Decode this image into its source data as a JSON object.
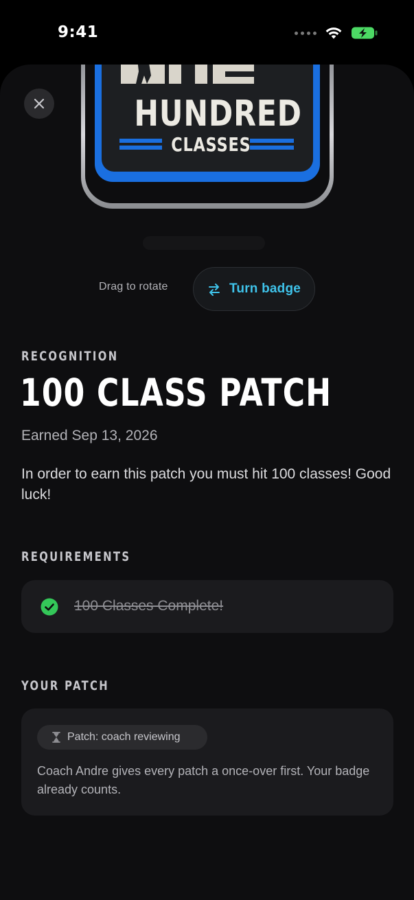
{
  "status_bar": {
    "time": "9:41"
  },
  "badge": {
    "line1": "ONE",
    "line2": "HUNDRED",
    "line3": "CLASSES"
  },
  "rotate": {
    "hint": "Drag to rotate",
    "button_label": "Turn badge"
  },
  "recognition": {
    "kicker": "RECOGNITION",
    "title": "100 CLASS PATCH",
    "earned": "Earned Sep 13, 2026",
    "description": "In order to earn this patch you must hit 100 classes! Good luck!"
  },
  "requirements": {
    "heading": "REQUIREMENTS",
    "items": [
      {
        "label": "100 Classes Complete!",
        "status": "complete"
      }
    ]
  },
  "your_patch": {
    "heading": "YOUR PATCH",
    "status_pill": "Patch: coach reviewing",
    "note": "Coach Andre gives every patch a once-over first. Your badge already counts."
  },
  "colors": {
    "accent": "#3fc3ea",
    "badge_blue": "#1a6fe0",
    "success": "#34c759",
    "battery": "#4cd964"
  },
  "icons": {
    "close": "close-icon",
    "turn": "swap-arrows-icon",
    "check": "check-circle-icon",
    "hourglass": "hourglass-icon"
  }
}
